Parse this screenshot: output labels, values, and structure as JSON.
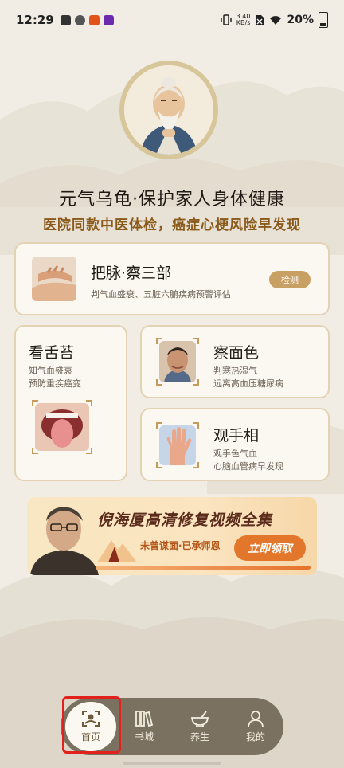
{
  "status_bar": {
    "time": "12:29",
    "net_speed_value": "3.40",
    "net_speed_unit": "KB/s",
    "battery": "20%"
  },
  "hero": {
    "headline": "元气乌龟·保护家人身体健康",
    "subline": "医院同款中医体检，癌症心梗风险早发现"
  },
  "cards": {
    "pulse": {
      "title": "把脉·察三部",
      "desc": "判气血盛衰、五脏六腑疾病预警评估",
      "button": "检测"
    },
    "tongue": {
      "title": "看舌苔",
      "desc_line1": "知气血盛衰",
      "desc_line2": "预防重疾癌变"
    },
    "face": {
      "title": "察面色",
      "desc_line1": "判寒热湿气",
      "desc_line2": "远离高血压糖尿病"
    },
    "hand": {
      "title": "观手相",
      "desc_line1": "观手色气血",
      "desc_line2": "心脑血管病早发现"
    }
  },
  "banner": {
    "title": "倪海厦高清修复视频全集",
    "subtitle": "未曾谋面·已承师恩",
    "button": "立即领取"
  },
  "tab_bar": {
    "items": [
      {
        "label": "首页",
        "icon": "scan-face-icon",
        "active": true
      },
      {
        "label": "书城",
        "icon": "books-icon",
        "active": false
      },
      {
        "label": "养生",
        "icon": "mortar-icon",
        "active": false
      },
      {
        "label": "我的",
        "icon": "person-icon",
        "active": false
      }
    ]
  },
  "colors": {
    "accent_gold": "#c9a064",
    "tab_bar_bg": "#7a7160",
    "banner_button": "#e2762a",
    "highlight": "#e2201c"
  }
}
